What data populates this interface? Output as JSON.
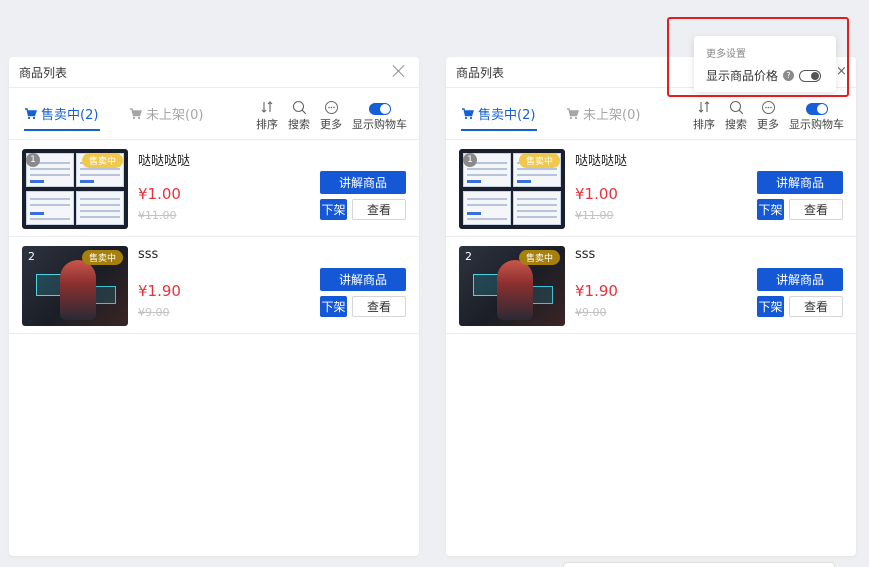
{
  "panels": [
    {
      "title": "商品列表",
      "tabs": [
        {
          "label": "售卖中(2)",
          "active": true
        },
        {
          "label": "未上架(0)",
          "active": false
        }
      ],
      "toolbar": {
        "sort": "排序",
        "search": "搜索",
        "more": "更多",
        "cart": "显示购物车"
      },
      "products": [
        {
          "index": "1",
          "status": "售卖中",
          "name": "哒哒哒哒",
          "price": "¥1.00",
          "original_price": "¥11.00",
          "explain": "讲解商品",
          "delist": "下架",
          "view": "查看"
        },
        {
          "index": "2",
          "status": "售卖中",
          "name": "sss",
          "price": "¥1.90",
          "original_price": "¥9.00",
          "explain": "讲解商品",
          "delist": "下架",
          "view": "查看"
        }
      ]
    },
    {
      "title": "商品列表",
      "tabs": [
        {
          "label": "售卖中(2)",
          "active": true
        },
        {
          "label": "未上架(0)",
          "active": false
        }
      ],
      "toolbar": {
        "sort": "排序",
        "search": "搜索",
        "more": "更多",
        "cart": "显示购物车"
      },
      "products": [
        {
          "index": "1",
          "status": "售卖中",
          "name": "哒哒哒哒",
          "price": "¥1.00",
          "original_price": "¥11.00",
          "explain": "讲解商品",
          "delist": "下架",
          "view": "查看"
        },
        {
          "index": "2",
          "status": "售卖中",
          "name": "sss",
          "price": "¥1.90",
          "original_price": "¥9.00",
          "explain": "讲解商品",
          "delist": "下架",
          "view": "查看"
        }
      ]
    }
  ],
  "popover": {
    "title": "更多设置",
    "show_price_label": "显示商品价格",
    "help": "?",
    "show_price_enabled": false
  },
  "colors": {
    "primary": "#1558d6",
    "price": "#e8313c",
    "selling_badge": "#a5800e",
    "highlight": "#e41e1e"
  },
  "icons": [
    "close-icon",
    "cart-icon",
    "sort-icon",
    "search-icon",
    "more-icon",
    "toggle-icon",
    "help-icon",
    "collapse-icon"
  ]
}
